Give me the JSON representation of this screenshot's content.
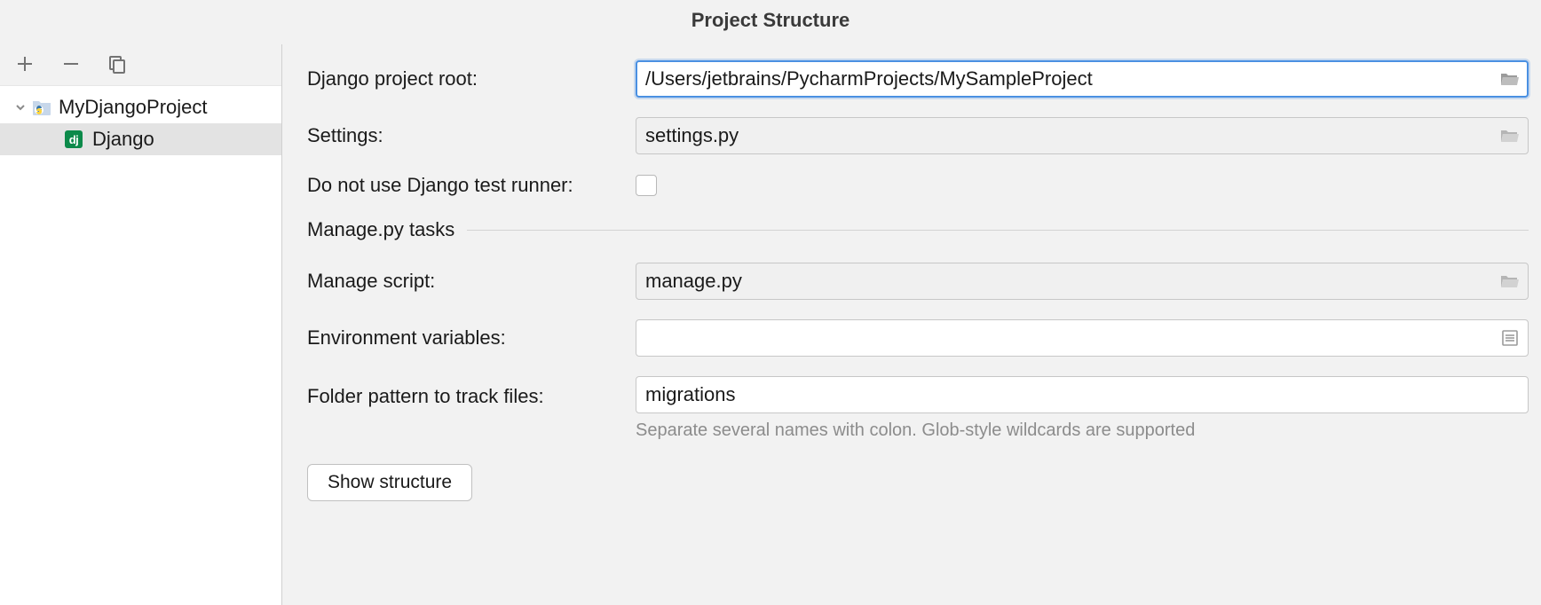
{
  "title": "Project Structure",
  "sidebar": {
    "project_name": "MyDjangoProject",
    "child_name": "Django"
  },
  "form": {
    "labels": {
      "root": "Django project root:",
      "settings": "Settings:",
      "no_test_runner": "Do not use Django test runner:",
      "manage_py_section": "Manage.py tasks",
      "manage_script": "Manage script:",
      "env_vars": "Environment variables:",
      "folder_pattern": "Folder pattern to track files:"
    },
    "values": {
      "root": "/Users/jetbrains/PycharmProjects/MySampleProject",
      "settings": "settings.py",
      "manage_script": "manage.py",
      "env_vars": "",
      "folder_pattern": "migrations"
    },
    "hint": "Separate several names with colon. Glob-style wildcards are supported",
    "show_structure_btn": "Show structure"
  }
}
